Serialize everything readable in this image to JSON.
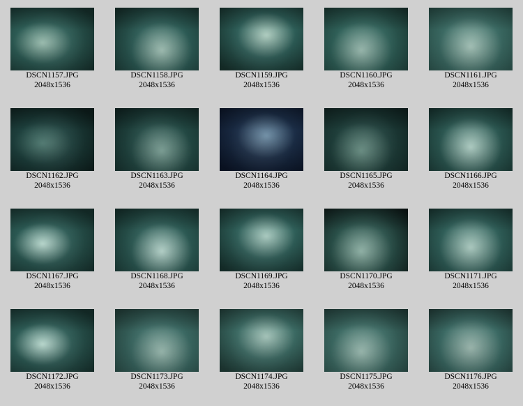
{
  "thumbnails": [
    {
      "filename": "DSCN1157.JPG",
      "dimensions": "2048x1536",
      "colors": [
        "#2d5c55",
        "#9fc4b5",
        "#16302c"
      ]
    },
    {
      "filename": "DSCN1158.JPG",
      "dimensions": "2048x1536",
      "colors": [
        "#2c5b55",
        "#a6c8bb",
        "#162f2b"
      ]
    },
    {
      "filename": "DSCN1159.JPG",
      "dimensions": "2048x1536",
      "colors": [
        "#2d5d57",
        "#b0d0c2",
        "#17312c"
      ]
    },
    {
      "filename": "DSCN1160.JPG",
      "dimensions": "2048x1536",
      "colors": [
        "#2f6058",
        "#9fc2b6",
        "#18332e"
      ]
    },
    {
      "filename": "DSCN1161.JPG",
      "dimensions": "2048x1536",
      "colors": [
        "#3b6a63",
        "#a7c8bc",
        "#244741"
      ]
    },
    {
      "filename": "DSCN1162.JPG",
      "dimensions": "2048x1536",
      "colors": [
        "#1d3f3c",
        "#4e7b72",
        "#0e1f1d"
      ]
    },
    {
      "filename": "DSCN1163.JPG",
      "dimensions": "2048x1536",
      "colors": [
        "#234944",
        "#7fa69b",
        "#112624"
      ]
    },
    {
      "filename": "DSCN1164.JPG",
      "dimensions": "2048x1536",
      "colors": [
        "#1b2d46",
        "#6e8fa7",
        "#0b1426"
      ]
    },
    {
      "filename": "DSCN1165.JPG",
      "dimensions": "2048x1536",
      "colors": [
        "#1f3f3b",
        "#6b9488",
        "#0f211f"
      ]
    },
    {
      "filename": "DSCN1166.JPG",
      "dimensions": "2048x1536",
      "colors": [
        "#2b5751",
        "#b4d6cb",
        "#15302c"
      ]
    },
    {
      "filename": "DSCN1167.JPG",
      "dimensions": "2048x1536",
      "colors": [
        "#2b5953",
        "#bfe1d6",
        "#17322e"
      ]
    },
    {
      "filename": "DSCN1168.JPG",
      "dimensions": "2048x1536",
      "colors": [
        "#2c5a54",
        "#bfe0d6",
        "#16312d"
      ]
    },
    {
      "filename": "DSCN1169.JPG",
      "dimensions": "2048x1536",
      "colors": [
        "#2f5f59",
        "#a9ccc1",
        "#17322e"
      ]
    },
    {
      "filename": "DSCN1170.JPG",
      "dimensions": "2048x1536",
      "colors": [
        "#2a514a",
        "#97bdb0",
        "#0c1615"
      ]
    },
    {
      "filename": "DSCN1171.JPG",
      "dimensions": "2048x1536",
      "colors": [
        "#2f5e58",
        "#b1d3c8",
        "#183430"
      ]
    },
    {
      "filename": "DSCN1172.JPG",
      "dimensions": "2048x1536",
      "colors": [
        "#2d5b55",
        "#c0e2d7",
        "#17322e"
      ]
    },
    {
      "filename": "DSCN1173.JPG",
      "dimensions": "2048x1536",
      "colors": [
        "#3a6862",
        "#9dbfb4",
        "#233f3a"
      ]
    },
    {
      "filename": "DSCN1174.JPG",
      "dimensions": "2048x1536",
      "colors": [
        "#3b6a63",
        "#a3c4b9",
        "#203c37"
      ]
    },
    {
      "filename": "DSCN1175.JPG",
      "dimensions": "2048x1536",
      "colors": [
        "#3c6a63",
        "#9fc1b6",
        "#213c38"
      ]
    },
    {
      "filename": "DSCN1176.JPG",
      "dimensions": "2048x1536",
      "colors": [
        "#3a6963",
        "#9dbbb1",
        "#213b37"
      ]
    }
  ]
}
